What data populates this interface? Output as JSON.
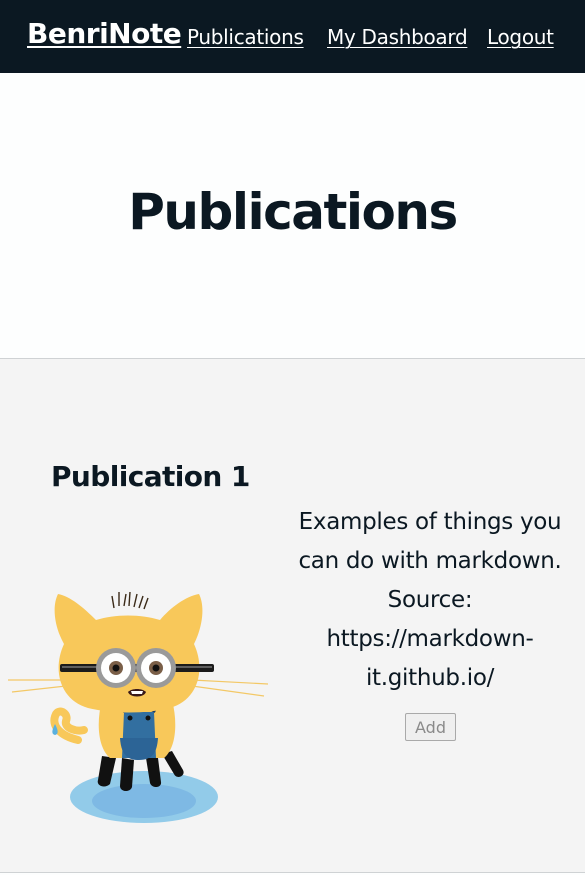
{
  "navbar": {
    "brand": "BenriNote",
    "links": [
      {
        "label": "Publications"
      },
      {
        "label": "My Dashboard"
      },
      {
        "label": "Logout"
      }
    ]
  },
  "hero": {
    "title": "Publications"
  },
  "publications": [
    {
      "title": "Publication 1",
      "description": "Examples of things you can do with markdown. Source: https://markdown-it.github.io/",
      "image_icon": "octocat-minion-image",
      "add_label": "Add"
    }
  ],
  "colors": {
    "navbar_bg": "#0b1822",
    "nav_text": "#ffffff",
    "content_bg": "#f4f4f4",
    "page_bg": "#fdfefe",
    "text": "#0b1822"
  }
}
